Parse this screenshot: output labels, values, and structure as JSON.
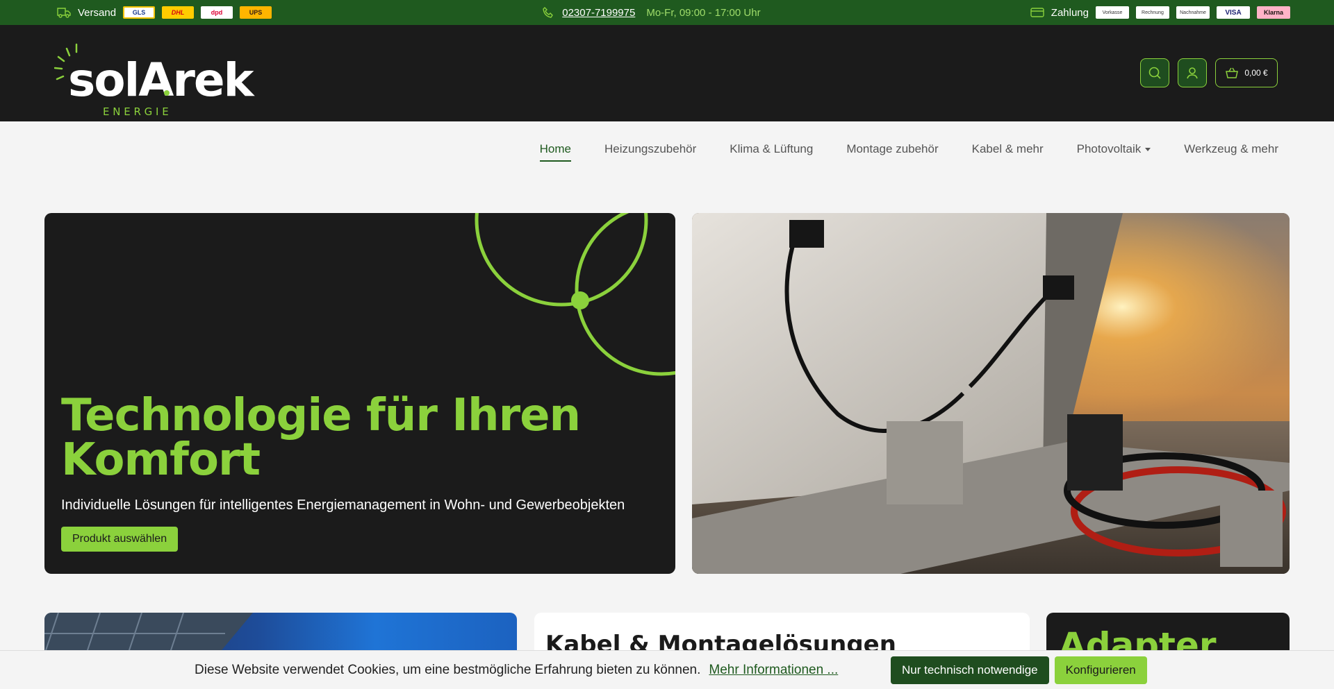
{
  "topbar": {
    "shipping_label": "Versand",
    "shipping_logos": [
      "GLS",
      "DHL",
      "dpd",
      "UPS"
    ],
    "phone": "02307-7199975",
    "hours": "Mo-Fr, 09:00 - 17:00 Uhr",
    "payment_label": "Zahlung",
    "payment_methods": [
      "Vorkasse",
      "Rechnung",
      "Nachnahme",
      "VISA",
      "Klarna"
    ]
  },
  "brand": {
    "name": "solArek",
    "tagline": "E N E R G I E"
  },
  "header": {
    "cart_total": "0,00 €"
  },
  "nav": {
    "items": [
      {
        "label": "Home"
      },
      {
        "label": "Heizungszubehör"
      },
      {
        "label": "Klima & Lüftung"
      },
      {
        "label": "Montage zubehör"
      },
      {
        "label": "Kabel & mehr"
      },
      {
        "label": "Photovoltaik"
      },
      {
        "label": "Werkzeug & mehr"
      }
    ]
  },
  "hero": {
    "title": "Technologie für Ihren Komfort",
    "subtitle": "Individuelle Lösungen für intelligentes Energiemanagement in Wohn- und Gewerbeobjekten",
    "button": "Produkt auswählen"
  },
  "cards": {
    "card2_title": "Kabel & Montagelösungen",
    "card3_title": "Adapter"
  },
  "cookie": {
    "text": "Diese Website verwendet Cookies, um eine bestmögliche Erfahrung bieten zu können.",
    "link": "Mehr Informationen ...",
    "btn_necessary": "Nur technisch notwendige",
    "btn_configure": "Konfigurieren"
  },
  "colors": {
    "accent": "#8bd13c",
    "dark_green": "#1f5a1f",
    "dark": "#1b1b1b"
  }
}
